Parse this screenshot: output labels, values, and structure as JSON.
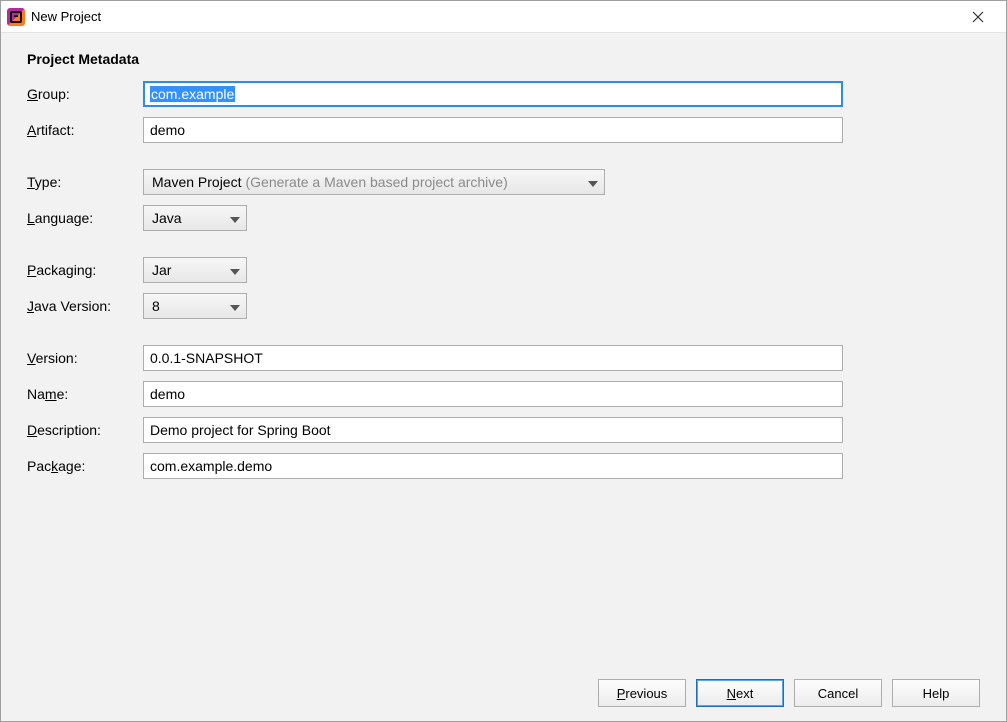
{
  "window": {
    "title": "New Project"
  },
  "heading": "Project Metadata",
  "labels": {
    "group": "roup:",
    "group_m": "G",
    "artifact": "rtifact:",
    "artifact_m": "A",
    "type": "ype:",
    "type_m": "T",
    "language": "anguage:",
    "language_m": "L",
    "packaging": "ackaging:",
    "packaging_m": "P",
    "java": "ava Version:",
    "java_m": "J",
    "version": "ersion:",
    "version_m": "V",
    "name": "e:",
    "name_pre": "Na",
    "name_m": "m",
    "description": "escription:",
    "description_m": "D",
    "package": "age:",
    "package_pre": "Pac",
    "package_m": "k"
  },
  "fields": {
    "group": "com.example",
    "artifact": "demo",
    "type": "Maven Project",
    "type_hint": "(Generate a Maven based project archive)",
    "language": "Java",
    "packaging": "Jar",
    "java_version": "8",
    "version": "0.0.1-SNAPSHOT",
    "name": "demo",
    "description": "Demo project for Spring Boot",
    "package": "com.example.demo"
  },
  "buttons": {
    "previous": "revious",
    "previous_m": "P",
    "next": "ext",
    "next_m": "N",
    "cancel": "Cancel",
    "help": "Help"
  }
}
